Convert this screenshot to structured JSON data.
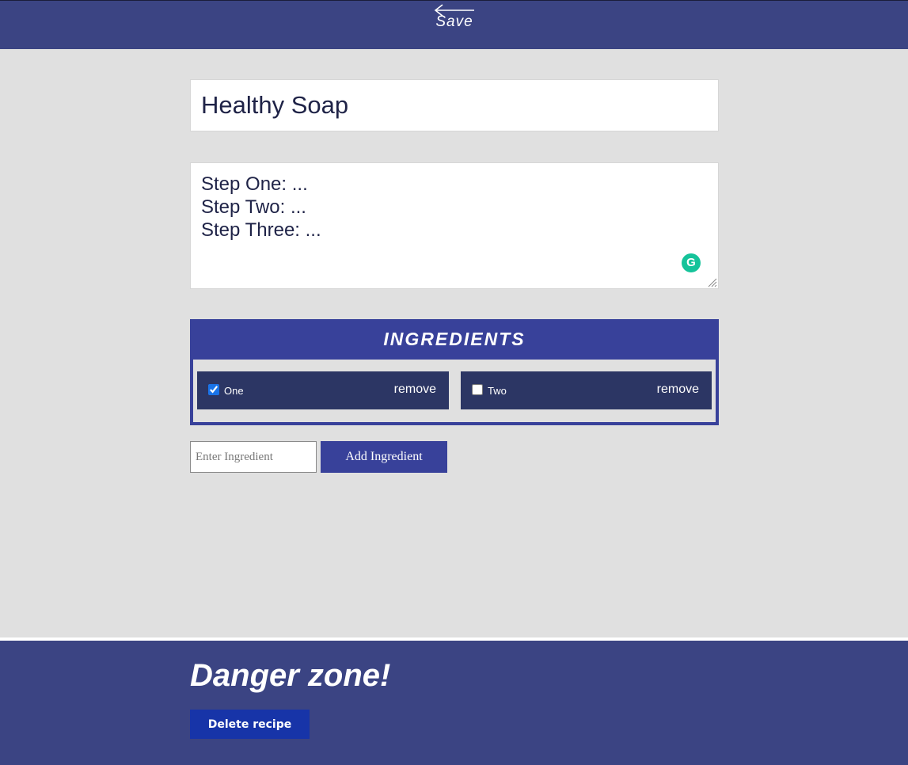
{
  "header": {
    "save_label": "Save",
    "back_icon": "left-arrow-icon"
  },
  "recipe": {
    "title": "Healthy Soap",
    "steps": "Step One: ...\nStep Two: ...\nStep Three: ..."
  },
  "ingredients": {
    "heading": "INGREDIENTS",
    "items": [
      {
        "name": "One",
        "checked": true,
        "remove_label": "remove"
      },
      {
        "name": "Two",
        "checked": false,
        "remove_label": "remove"
      }
    ],
    "input_placeholder": "Enter Ingredient",
    "add_label": "Add Ingredient"
  },
  "danger_zone": {
    "title": "Danger zone!",
    "delete_label": "Delete recipe"
  },
  "colors": {
    "header_bg": "#3b4483",
    "ingredients_bg": "#38419a",
    "ingredient_item_bg": "#2c3664",
    "delete_bg": "#1734a8",
    "page_bg": "#e0e0e0",
    "grammarly": "#15c39a"
  }
}
